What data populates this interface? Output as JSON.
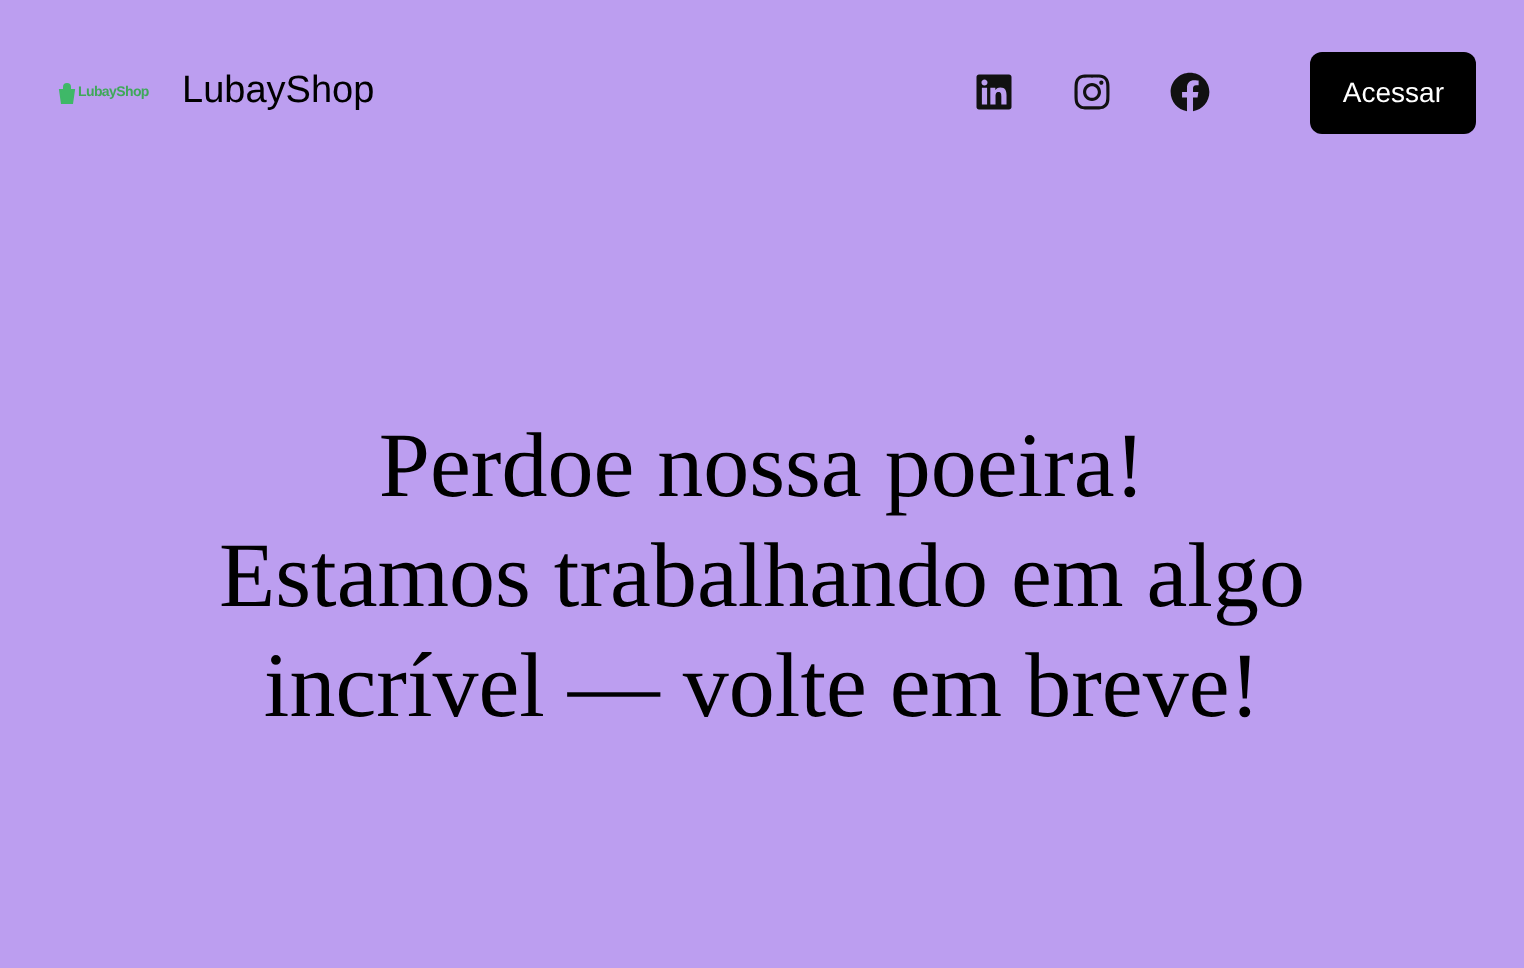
{
  "header": {
    "logo_text": "LubayShop",
    "brand": "LubayShop",
    "social_links": [
      {
        "kind": "linkedin"
      },
      {
        "kind": "instagram"
      },
      {
        "kind": "facebook"
      }
    ],
    "login_button": "Acessar"
  },
  "hero": {
    "lines": [
      "Perdoe nossa poeira!",
      "Estamos trabalhando em algo",
      "incrível — volte em breve!"
    ]
  }
}
